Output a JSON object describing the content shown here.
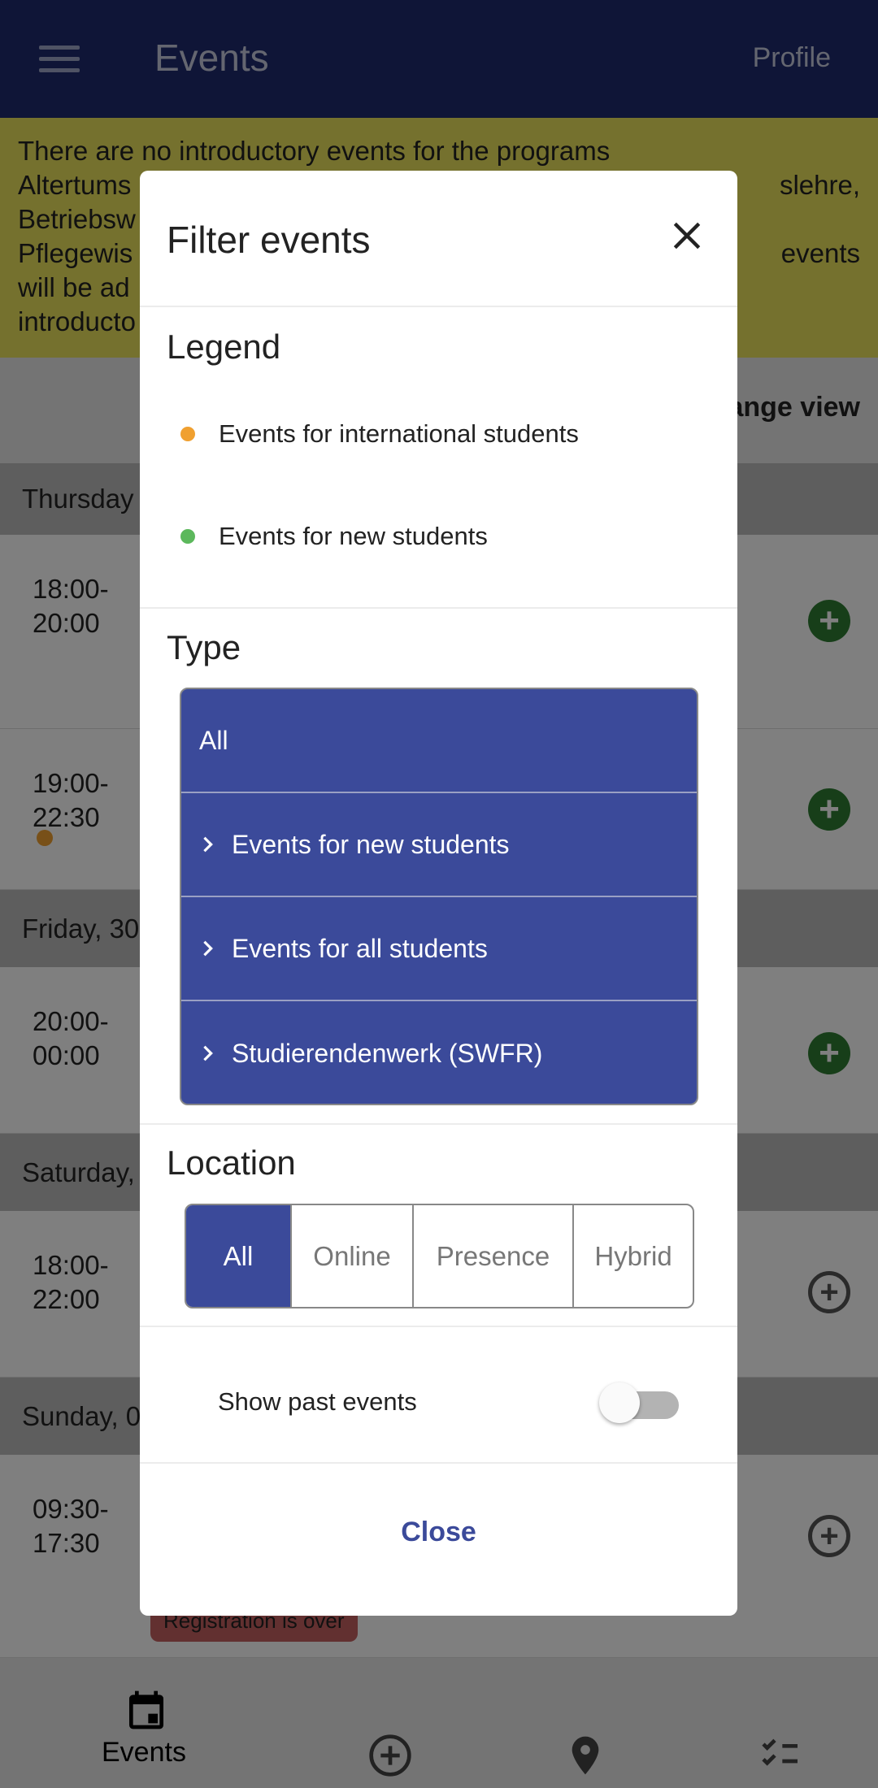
{
  "header": {
    "title": "Events",
    "profile_label": "Profile",
    "menu_icon": "hamburger-icon"
  },
  "banner": {
    "lines": [
      "There are no introductory events for the programs",
      "Altertums",
      "Betriebsw",
      "Pflegewis",
      "will be ad",
      "introducto"
    ],
    "right_fragments": [
      "slehre,",
      "events"
    ]
  },
  "view": {
    "change_view_label": "ange view"
  },
  "days": [
    {
      "label": "Thursday",
      "events": [
        {
          "time_start": "18:00-",
          "time_end": "20:00",
          "registered": false,
          "dot": null
        },
        {
          "time_start": "19:00-",
          "time_end": "22:30",
          "registered": false,
          "dot": "#f0a030"
        }
      ]
    },
    {
      "label": "Friday, 30",
      "events": [
        {
          "time_start": "20:00-",
          "time_end": "00:00",
          "registered": false
        }
      ]
    },
    {
      "label": "Saturday,",
      "events": [
        {
          "time_start": "18:00-",
          "time_end": "22:00",
          "registered": false
        }
      ]
    },
    {
      "label": "Sunday, 0",
      "events": [
        {
          "time_start": "09:30-",
          "time_end": "17:30",
          "badge": "Registration is over"
        }
      ]
    }
  ],
  "bottom_nav": {
    "items": [
      {
        "label": "Events",
        "icon": "calendar-icon"
      },
      {
        "icon": "add-circle-icon"
      },
      {
        "icon": "location-pin-icon"
      },
      {
        "icon": "checklist-icon"
      }
    ]
  },
  "dialog": {
    "title": "Filter events",
    "legend": {
      "heading": "Legend",
      "items": [
        {
          "label": "Events for international students",
          "color": "#f0a030"
        },
        {
          "label": "Events for new students",
          "color": "#5cb85c"
        }
      ]
    },
    "type": {
      "heading": "Type",
      "items": [
        "All",
        "Events for new students",
        "Events for all students",
        "Studierendenwerk (SWFR)"
      ],
      "selected": "All"
    },
    "location": {
      "heading": "Location",
      "options": [
        "All",
        "Online",
        "Presence",
        "Hybrid"
      ],
      "selected": "All"
    },
    "show_past": {
      "label": "Show past events",
      "enabled": false
    },
    "close_label": "Close"
  },
  "colors": {
    "primary": "#3b4a9a",
    "header": "#1f2b6e",
    "banner": "#eae25c",
    "add_green": "#2e7d32"
  }
}
